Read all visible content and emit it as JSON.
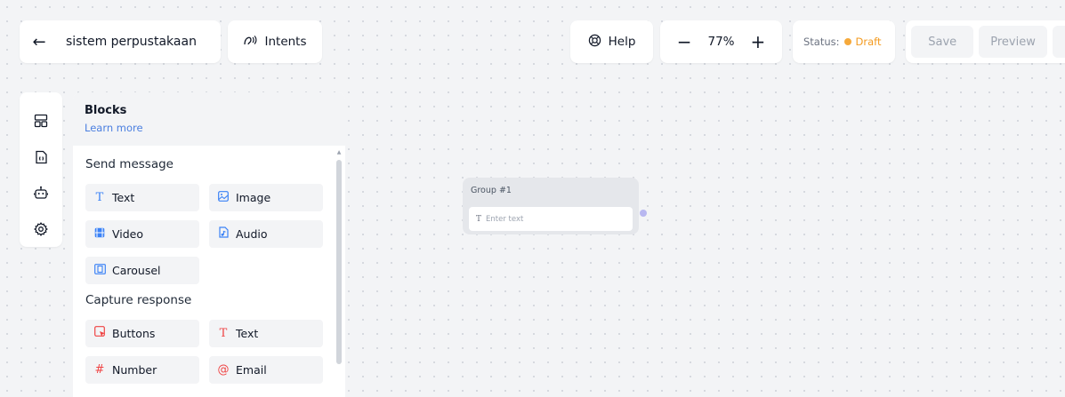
{
  "topbar": {
    "back_icon": "arrow-left-icon",
    "project_name": "sistem perpustakaan",
    "intents_label": "Intents",
    "help_label": "Help",
    "zoom": {
      "minus": "−",
      "level": "77%",
      "plus": "+"
    },
    "status_label": "Status:",
    "status_value": "Draft",
    "status_color": "#f6a93b",
    "save_label": "Save",
    "preview_label": "Preview"
  },
  "side_rail": {
    "icons": [
      "blocks-icon",
      "document-variable-icon",
      "bot-icon",
      "gear-icon"
    ]
  },
  "blocks_panel": {
    "title": "Blocks",
    "learn_more": "Learn more",
    "send_message": {
      "title": "Send message",
      "items": [
        {
          "label": "Text",
          "icon": "text-icon"
        },
        {
          "label": "Image",
          "icon": "image-icon"
        },
        {
          "label": "Video",
          "icon": "video-icon"
        },
        {
          "label": "Audio",
          "icon": "audio-icon"
        },
        {
          "label": "Carousel",
          "icon": "carousel-icon"
        }
      ]
    },
    "capture_response": {
      "title": "Capture response",
      "items": [
        {
          "label": "Buttons",
          "icon": "buttons-icon"
        },
        {
          "label": "Text",
          "icon": "text-icon"
        },
        {
          "label": "Number",
          "icon": "hash-icon"
        },
        {
          "label": "Email",
          "icon": "at-icon"
        }
      ]
    }
  },
  "canvas": {
    "group": {
      "title": "Group #1",
      "input_placeholder": "Enter text"
    }
  },
  "colors": {
    "accent_blue": "#3b82f6",
    "accent_red": "#ef4444",
    "connector": "#b8b7f0"
  }
}
